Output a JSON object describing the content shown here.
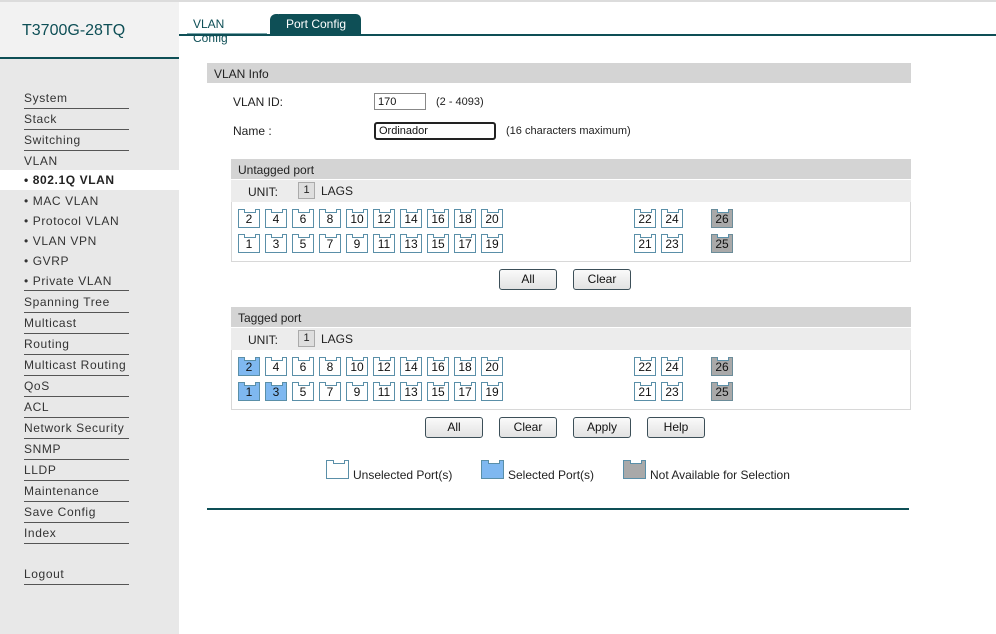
{
  "device": {
    "title": "T3700G-28TQ"
  },
  "tabs": [
    {
      "label": "VLAN Config"
    },
    {
      "label": "Port Config"
    }
  ],
  "menu": {
    "top": [
      "System",
      "Stack",
      "Switching",
      "VLAN"
    ],
    "vlan_sub": [
      "• 802.1Q VLAN",
      "• MAC VLAN",
      "• Protocol VLAN",
      "• VLAN VPN",
      "• GVRP",
      "• Private VLAN"
    ],
    "rest": [
      "Spanning Tree",
      "Multicast",
      "Routing",
      "Multicast Routing",
      "QoS",
      "ACL",
      "Network Security",
      "SNMP",
      "LLDP",
      "Maintenance",
      "Save Config",
      "Index"
    ],
    "logout": "Logout"
  },
  "vlan_info": {
    "header": "VLAN Info",
    "vlan_id_label": "VLAN ID:",
    "vlan_id_value": "170",
    "vlan_id_hint": "(2 - 4093)",
    "name_label": "Name :",
    "name_value": "Ordinador",
    "name_hint": "(16 characters maximum)"
  },
  "untagged": {
    "header": "Untagged port",
    "unit_label": "UNIT:",
    "unit_value": "1",
    "lags_label": "LAGS",
    "selected": [],
    "buttons": {
      "all": "All",
      "clear": "Clear"
    }
  },
  "tagged": {
    "header": "Tagged port",
    "unit_label": "UNIT:",
    "unit_value": "1",
    "lags_label": "LAGS",
    "selected": [
      "1",
      "2",
      "3"
    ],
    "buttons": {
      "all": "All",
      "clear": "Clear",
      "apply": "Apply",
      "help": "Help"
    }
  },
  "ports": {
    "even_row": [
      "2",
      "4",
      "6",
      "8",
      "10",
      "12",
      "14",
      "16",
      "18",
      "20"
    ],
    "odd_row": [
      "1",
      "3",
      "5",
      "7",
      "9",
      "11",
      "13",
      "15",
      "17",
      "19"
    ],
    "even_sfp": [
      "22",
      "24"
    ],
    "odd_sfp": [
      "21",
      "23"
    ],
    "even_na": [
      "26"
    ],
    "odd_na": [
      "25"
    ]
  },
  "legend": {
    "unselected": "Unselected Port(s)",
    "selected": "Selected Port(s)",
    "unavailable": "Not Available for Selection"
  },
  "colors": {
    "accent": "#0e4f56",
    "selected_port": "#7fb8f0",
    "unavailable_port": "#a9a9a9"
  }
}
